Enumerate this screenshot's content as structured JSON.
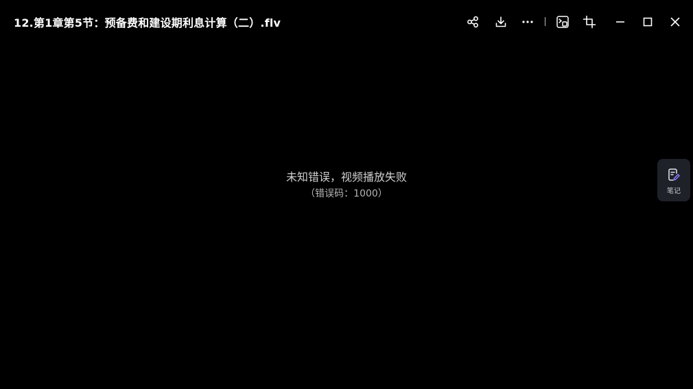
{
  "window": {
    "title": "12.第1章第5节：预备费和建设期利息计算（二）.flv"
  },
  "toolbar": {
    "icons": [
      "share-icon",
      "download-icon",
      "more-icon",
      "screen-capture-icon",
      "crop-icon",
      "minimize-icon",
      "maximize-icon",
      "close-icon"
    ]
  },
  "player": {
    "error_message": "未知错误，视频播放失败",
    "error_code": "（错误码：1000）"
  },
  "side_panel": {
    "notes_label": "笔记"
  },
  "colors": {
    "background": "#000000",
    "notes_button_bg": "#1f2129",
    "notes_icon_accent": "#8b7cff"
  }
}
